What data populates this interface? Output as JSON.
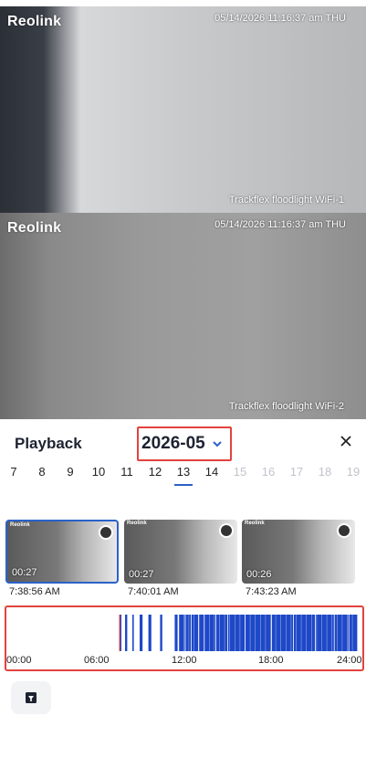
{
  "feeds": [
    {
      "logo": "Reolink",
      "timestamp": "05/14/2026 11:16:37 am THU",
      "camera": "Trackflex floodlight WiFi-1"
    },
    {
      "logo": "Reolink",
      "timestamp": "05/14/2026 11:16:37 am THU",
      "camera": "Trackflex floodlight WiFi-2"
    }
  ],
  "panel": {
    "title": "Playback",
    "month": "2026-05",
    "days": [
      {
        "label": "7",
        "state": "normal"
      },
      {
        "label": "8",
        "state": "normal"
      },
      {
        "label": "9",
        "state": "normal"
      },
      {
        "label": "10",
        "state": "normal"
      },
      {
        "label": "11",
        "state": "normal"
      },
      {
        "label": "12",
        "state": "normal"
      },
      {
        "label": "13",
        "state": "selected"
      },
      {
        "label": "14",
        "state": "normal"
      },
      {
        "label": "15",
        "state": "dim"
      },
      {
        "label": "16",
        "state": "dim"
      },
      {
        "label": "17",
        "state": "dim"
      },
      {
        "label": "18",
        "state": "dim"
      },
      {
        "label": "19",
        "state": "dim"
      }
    ],
    "clips": [
      {
        "duration": "00:27",
        "time": "7:38:56 AM",
        "active": true,
        "logo": "Reolink"
      },
      {
        "duration": "00:27",
        "time": "7:40:01 AM",
        "active": false,
        "logo": "Reolink"
      },
      {
        "duration": "00:26",
        "time": "7:43:23 AM",
        "active": false,
        "logo": "Reolink"
      }
    ],
    "timeline": {
      "hours": [
        "00:00",
        "06:00",
        "12:00",
        "18:00",
        "24:00"
      ],
      "cursor_hour": 7.6,
      "events": [
        [
          7.6,
          7.75
        ],
        [
          8.0,
          8.15
        ],
        [
          8.5,
          8.6
        ],
        [
          9.0,
          9.2
        ],
        [
          9.6,
          9.8
        ],
        [
          10.4,
          10.55
        ],
        [
          11.4,
          11.6
        ],
        [
          11.7,
          12.1
        ],
        [
          12.15,
          12.5
        ],
        [
          12.55,
          13.0
        ],
        [
          13.05,
          13.4
        ],
        [
          13.45,
          14.2
        ],
        [
          14.25,
          15.0
        ],
        [
          15.05,
          16.2
        ],
        [
          16.25,
          18.0
        ],
        [
          18.05,
          19.5
        ],
        [
          19.55,
          21.0
        ],
        [
          21.05,
          22.3
        ],
        [
          22.35,
          23.3
        ],
        [
          23.35,
          23.9
        ]
      ],
      "event_color": "#1e48c7",
      "cursor_color": "#e2433e"
    },
    "accent": "#2a62c9",
    "highlight": "#e2433e"
  }
}
